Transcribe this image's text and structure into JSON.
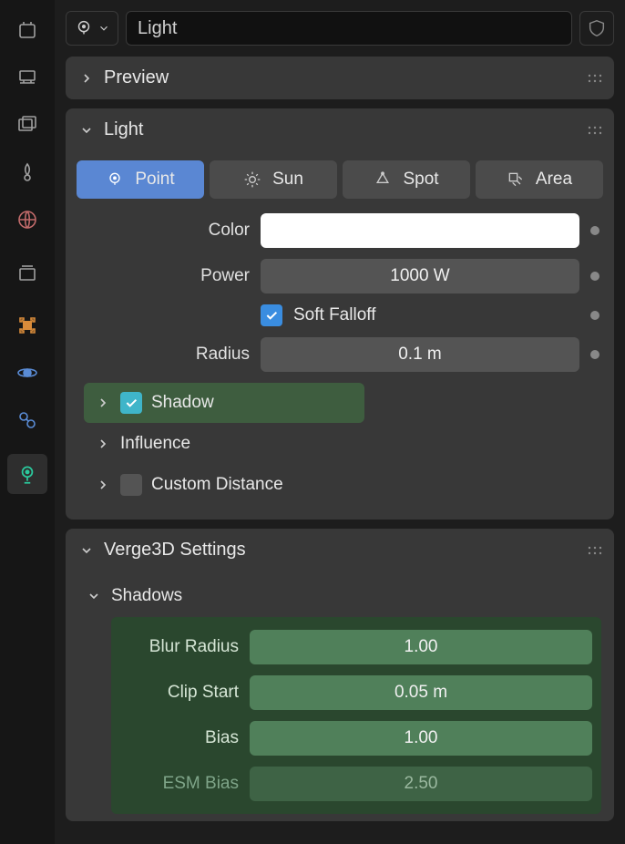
{
  "header": {
    "object_name": "Light"
  },
  "panels": {
    "preview": {
      "title": "Preview"
    },
    "light": {
      "title": "Light",
      "types": {
        "point": "Point",
        "sun": "Sun",
        "spot": "Spot",
        "area": "Area"
      },
      "color_label": "Color",
      "power_label": "Power",
      "power_value": "1000 W",
      "soft_falloff_label": "Soft Falloff",
      "radius_label": "Radius",
      "radius_value": "0.1 m",
      "shadow_label": "Shadow",
      "influence_label": "Influence",
      "custom_distance_label": "Custom Distance"
    },
    "verge3d": {
      "title": "Verge3D Settings",
      "shadows_label": "Shadows",
      "blur_radius_label": "Blur Radius",
      "blur_radius_value": "1.00",
      "clip_start_label": "Clip Start",
      "clip_start_value": "0.05 m",
      "bias_label": "Bias",
      "bias_value": "1.00",
      "esm_bias_label": "ESM Bias",
      "esm_bias_value": "2.50"
    }
  }
}
